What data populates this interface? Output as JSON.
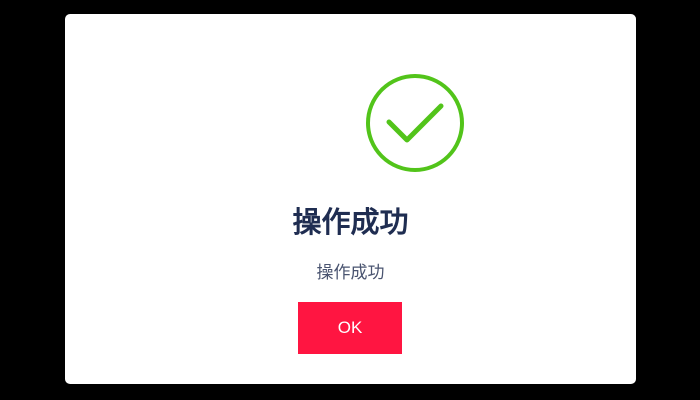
{
  "dialog": {
    "title": "操作成功",
    "message": "操作成功",
    "ok_label": "OK",
    "icon": "check-circle-icon"
  },
  "colors": {
    "backdrop": "#000000",
    "dialog_background": "#ffffff",
    "success_green": "#52c41a",
    "title_text": "#1f2d51",
    "message_text": "#4a5470",
    "button_background": "#ff1541",
    "button_text": "#ffffff"
  }
}
